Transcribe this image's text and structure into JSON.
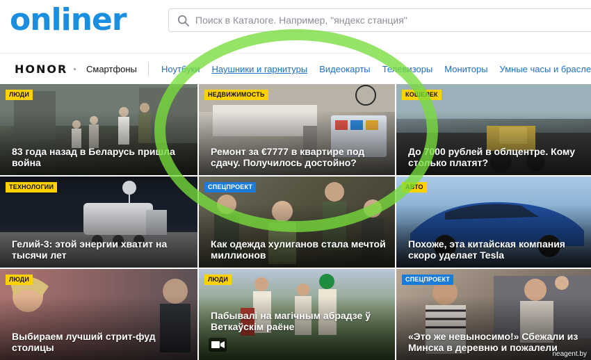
{
  "header": {
    "logo": "onliner",
    "search_placeholder": "Поиск в Каталоге. Например, \"яндекс станция\""
  },
  "nav": {
    "brand": "HONOR",
    "brand_category": "Смартфоны",
    "links": [
      "Ноутбуки",
      "Наушники и гарнитуры",
      "Видеокарты",
      "Телевизоры",
      "Мониторы",
      "Умные часы и браслеты"
    ]
  },
  "tiles": [
    {
      "badge": "ЛЮДИ",
      "title": "83 года назад в Беларусь пришла война"
    },
    {
      "badge": "НЕДВИЖИМОСТЬ",
      "title": "Ремонт за €7777 в квартире под сдачу. Получилось достойно?"
    },
    {
      "badge": "КОШЕЛЕК",
      "title": "До 7000 рублей в облцентре. Кому столько платят?"
    },
    {
      "badge": "ТЕХНОЛОГИИ",
      "title": "Гелий-3: этой энергии хватит на тысячи лет"
    },
    {
      "badge": "СПЕЦПРОЕКТ",
      "title": "Как одежда хулиганов стала мечтой миллионов"
    },
    {
      "badge": "АВТО",
      "title": "Похоже, эта китайская компания скоро уделает Tesla"
    },
    {
      "badge": "ЛЮДИ",
      "title": "Выбираем лучший стрит-фуд столицы"
    },
    {
      "badge": "ЛЮДИ",
      "title": "Пабывалі на магічным абрадзе ў Веткаўскім раёне"
    },
    {
      "badge": "СПЕЦПРОЕКТ",
      "title": "«Это же невыносимо!» Сбежали из Минска в деревню и пожалели"
    }
  ],
  "watermark": "neagent.by",
  "colors": {
    "brand_blue": "#1a8fe0",
    "link_blue": "#1d6fc3",
    "badge_yellow": "#ffd200",
    "badge_blue": "#1a7bd8",
    "highlight_ring": "#78dc3c"
  }
}
